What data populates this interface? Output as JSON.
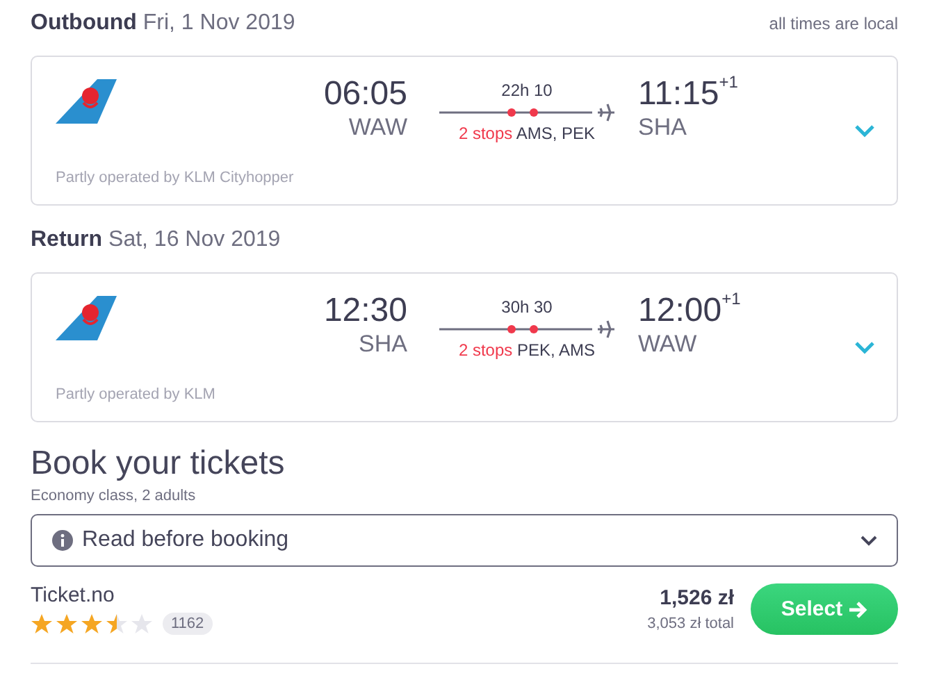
{
  "flights": [
    {
      "direction": "Outbound",
      "date": "Fri, 1 Nov 2019",
      "note": "all times are local",
      "departure_time": "06:05",
      "departure_airport": "WAW",
      "duration": "22h 10",
      "arrival_time": "11:15",
      "day_offset": "+1",
      "arrival_airport": "SHA",
      "stops": "2 stops",
      "stop_airports": "AMS, PEK",
      "operated_by": "Partly operated by KLM Cityhopper"
    },
    {
      "direction": "Return",
      "date": "Sat, 16 Nov 2019",
      "departure_time": "12:30",
      "departure_airport": "SHA",
      "duration": "30h 30",
      "arrival_time": "12:00",
      "day_offset": "+1",
      "arrival_airport": "WAW",
      "stops": "2 stops",
      "stop_airports": "PEK, AMS",
      "operated_by": "Partly operated by KLM"
    }
  ],
  "booking": {
    "title": "Book your tickets",
    "subtitle": "Economy class, 2 adults",
    "info_dropdown": "Read before booking",
    "offers": [
      {
        "provider": "Ticket.no",
        "stars": 3.5,
        "reviews": "1162",
        "price": "1,526 zł",
        "total": "3,053 zł total",
        "button": "Select"
      }
    ]
  }
}
